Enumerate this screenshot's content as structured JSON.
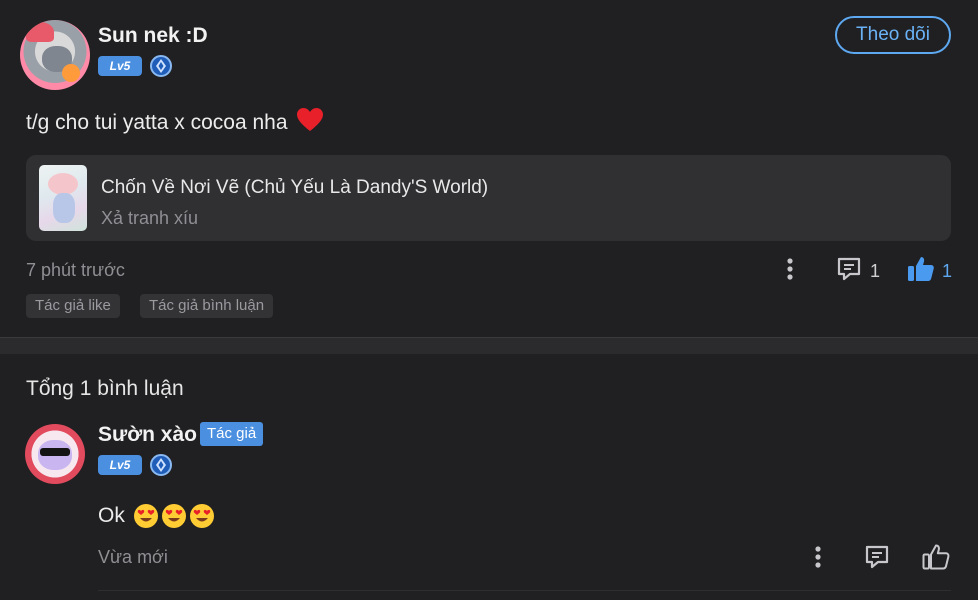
{
  "post": {
    "author": {
      "name": "Sun nek :D",
      "level": "Lv5"
    },
    "follow_label": "Theo dõi",
    "text": "t/g cho tui yatta x cocoa nha",
    "text_emoji": "red-heart",
    "linked_card": {
      "title": "Chốn Về Nơi Vẽ (Chủ Yếu Là Dandy'S World)",
      "subtitle": "Xả tranh xíu"
    },
    "time": "7 phút trước",
    "comment_count": "1",
    "like_count": "1",
    "tags": [
      "Tác giả like",
      "Tác giả bình luận"
    ]
  },
  "comments_section": {
    "total_label": "Tổng 1 bình luận",
    "comments": [
      {
        "author": "Sườn xào",
        "author_badge": "Tác giả",
        "level": "Lv5",
        "text": "Ok",
        "text_emoji": "heart-eyes x3",
        "time": "Vừa mới"
      }
    ]
  },
  "colors": {
    "background": "#202022",
    "accent_blue": "#5da8f0",
    "card_bg": "#303033",
    "muted_text": "#8f8f94"
  },
  "icons": [
    "more-vertical-icon",
    "comment-icon",
    "thumbs-up-icon",
    "medal-icon"
  ]
}
